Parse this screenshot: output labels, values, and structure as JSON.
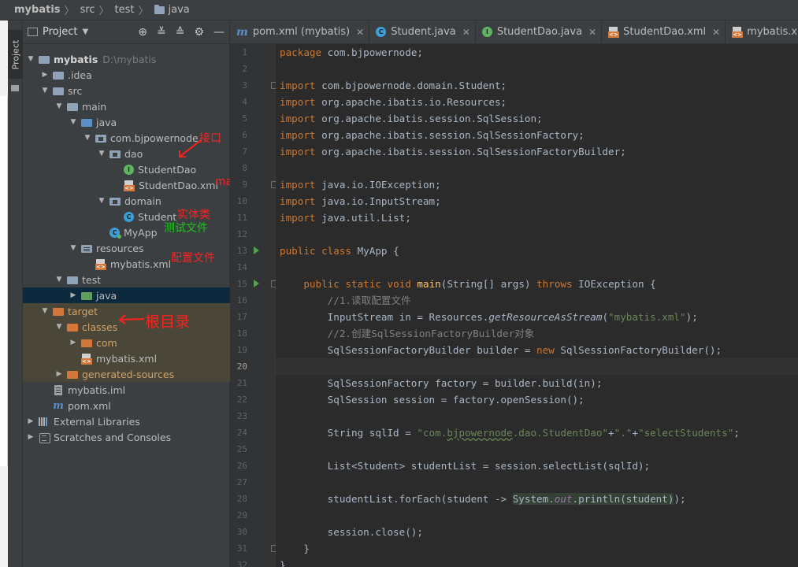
{
  "breadcrumb": [
    {
      "label": "mybatis",
      "bold": true
    },
    {
      "label": "src"
    },
    {
      "label": "test"
    },
    {
      "label": "java",
      "folder": true
    }
  ],
  "tool_window_stripe": {
    "label": "Project"
  },
  "project_panel": {
    "title": "Project",
    "tools": [
      "crosshair-icon",
      "expand-all-icon",
      "collapse-all-icon",
      "gear-icon",
      "minimize-icon"
    ]
  },
  "tree": [
    {
      "label": "mybatis",
      "hint": "D:\\mybatis",
      "depth": 0,
      "arrow": "down",
      "icon": "folder",
      "style": "root"
    },
    {
      "label": ".idea",
      "depth": 1,
      "arrow": "right",
      "icon": "folder"
    },
    {
      "label": "src",
      "depth": 1,
      "arrow": "down",
      "icon": "folder"
    },
    {
      "label": "main",
      "depth": 2,
      "arrow": "down",
      "icon": "folder"
    },
    {
      "label": "java",
      "depth": 3,
      "arrow": "down",
      "icon": "folder-blue"
    },
    {
      "label": "com.bjpowernode",
      "depth": 4,
      "arrow": "down",
      "icon": "package"
    },
    {
      "label": "dao",
      "depth": 5,
      "arrow": "down",
      "icon": "package"
    },
    {
      "label": "StudentDao",
      "depth": 6,
      "arrow": "none",
      "icon": "interface"
    },
    {
      "label": "StudentDao.xml",
      "depth": 6,
      "arrow": "none",
      "icon": "xml"
    },
    {
      "label": "domain",
      "depth": 5,
      "arrow": "down",
      "icon": "package"
    },
    {
      "label": "Student",
      "depth": 6,
      "arrow": "none",
      "icon": "class"
    },
    {
      "label": "MyApp",
      "depth": 5,
      "arrow": "none",
      "icon": "class-run"
    },
    {
      "label": "resources",
      "depth": 3,
      "arrow": "down",
      "icon": "folder-res"
    },
    {
      "label": "mybatis.xml",
      "depth": 4,
      "arrow": "none",
      "icon": "xml"
    },
    {
      "label": "test",
      "depth": 2,
      "arrow": "down",
      "icon": "folder"
    },
    {
      "label": "java",
      "depth": 3,
      "arrow": "right",
      "icon": "folder-green",
      "selected": true
    },
    {
      "label": "target",
      "depth": 1,
      "arrow": "down",
      "icon": "folder-orange",
      "excluded": true
    },
    {
      "label": "classes",
      "depth": 2,
      "arrow": "down",
      "icon": "folder-orange",
      "excluded": true
    },
    {
      "label": "com",
      "depth": 3,
      "arrow": "right",
      "icon": "folder-orange",
      "excluded": true
    },
    {
      "label": "mybatis.xml",
      "depth": 3,
      "arrow": "none",
      "icon": "xml",
      "excluded": true
    },
    {
      "label": "generated-sources",
      "depth": 2,
      "arrow": "right",
      "icon": "folder-orange",
      "excluded": true
    },
    {
      "label": "mybatis.iml",
      "depth": 1,
      "arrow": "none",
      "icon": "iml"
    },
    {
      "label": "pom.xml",
      "depth": 1,
      "arrow": "none",
      "icon": "maven"
    },
    {
      "label": "External Libraries",
      "depth": 0,
      "arrow": "right",
      "icon": "libraries"
    },
    {
      "label": "Scratches and Consoles",
      "depth": 0,
      "arrow": "right",
      "icon": "scratches"
    }
  ],
  "annotations": [
    {
      "text": "接口",
      "color": "red",
      "size": "normal"
    },
    {
      "text": "mapper文件",
      "color": "red",
      "size": "normal"
    },
    {
      "text": "实体类",
      "color": "red",
      "size": "normal"
    },
    {
      "text": "测试文件",
      "color": "green",
      "size": "normal"
    },
    {
      "text": "配置文件",
      "color": "red",
      "size": "normal"
    },
    {
      "text": "根目录",
      "color": "red",
      "size": "big"
    }
  ],
  "tabs": [
    {
      "label": "pom.xml (mybatis)",
      "icon": "maven"
    },
    {
      "label": "Student.java",
      "icon": "class"
    },
    {
      "label": "StudentDao.java",
      "icon": "interface"
    },
    {
      "label": "StudentDao.xml",
      "icon": "xml"
    },
    {
      "label": "mybatis.xml",
      "icon": "xml"
    },
    {
      "label": "M",
      "icon": "class",
      "active": true
    }
  ],
  "editor": {
    "current_line": 20,
    "run_markers": [
      13,
      15
    ],
    "fold_markers": [
      3,
      9,
      15,
      31
    ],
    "lines": [
      {
        "n": 1,
        "t": [
          [
            "kw",
            "package "
          ],
          [
            "",
            "com.bjpowernode;"
          ]
        ]
      },
      {
        "n": 2,
        "t": []
      },
      {
        "n": 3,
        "t": [
          [
            "kw",
            "import "
          ],
          [
            "",
            "com.bjpowernode.domain.Student;"
          ]
        ]
      },
      {
        "n": 4,
        "t": [
          [
            "kw",
            "import "
          ],
          [
            "",
            "org.apache.ibatis.io.Resources;"
          ]
        ]
      },
      {
        "n": 5,
        "t": [
          [
            "kw",
            "import "
          ],
          [
            "",
            "org.apache.ibatis.session.SqlSession;"
          ]
        ]
      },
      {
        "n": 6,
        "t": [
          [
            "kw",
            "import "
          ],
          [
            "",
            "org.apache.ibatis.session.SqlSessionFactory;"
          ]
        ]
      },
      {
        "n": 7,
        "t": [
          [
            "kw",
            "import "
          ],
          [
            "",
            "org.apache.ibatis.session.SqlSessionFactoryBuilder;"
          ]
        ]
      },
      {
        "n": 8,
        "t": []
      },
      {
        "n": 9,
        "t": [
          [
            "kw",
            "import "
          ],
          [
            "",
            "java.io.IOException;"
          ]
        ]
      },
      {
        "n": 10,
        "t": [
          [
            "kw",
            "import "
          ],
          [
            "",
            "java.io.InputStream;"
          ]
        ]
      },
      {
        "n": 11,
        "t": [
          [
            "kw",
            "import "
          ],
          [
            "",
            "java.util.List;"
          ]
        ]
      },
      {
        "n": 12,
        "t": []
      },
      {
        "n": 13,
        "t": [
          [
            "kw",
            "public class "
          ],
          [
            "",
            "MyApp {"
          ]
        ]
      },
      {
        "n": 14,
        "t": []
      },
      {
        "n": 15,
        "t": [
          [
            "",
            "    "
          ],
          [
            "kw",
            "public static void "
          ],
          [
            "fn",
            "main"
          ],
          [
            "",
            "(String[] args) "
          ],
          [
            "kw",
            "throws "
          ],
          [
            "",
            "IOException {"
          ]
        ]
      },
      {
        "n": 16,
        "t": [
          [
            "",
            "        "
          ],
          [
            "cmt",
            "//1.读取配置文件"
          ]
        ]
      },
      {
        "n": 17,
        "t": [
          [
            "",
            "        InputStream in = Resources."
          ],
          [
            "it",
            "getResourceAsStream"
          ],
          [
            "",
            "("
          ],
          [
            "str",
            "\"mybatis.xml\""
          ],
          [
            "",
            "); "
          ]
        ]
      },
      {
        "n": 18,
        "t": [
          [
            "",
            "        "
          ],
          [
            "cmt",
            "//2.创建SqlSessionFactoryBuilder对象"
          ]
        ]
      },
      {
        "n": 19,
        "t": [
          [
            "",
            "        SqlSessionFactoryBuilder builder = "
          ],
          [
            "kw",
            "new "
          ],
          [
            "",
            "SqlSessionFactoryBuilder();"
          ]
        ]
      },
      {
        "n": 20,
        "t": []
      },
      {
        "n": 21,
        "t": [
          [
            "",
            "        SqlSessionFactory factory = builder.build(in);"
          ]
        ]
      },
      {
        "n": 22,
        "t": [
          [
            "",
            "        SqlSession session = factory.openSession();"
          ]
        ]
      },
      {
        "n": 23,
        "t": []
      },
      {
        "n": 24,
        "t": [
          [
            "",
            "        String sqlId = "
          ],
          [
            "str",
            "\"com."
          ],
          [
            "str squig",
            "bjpowernode"
          ],
          [
            "str",
            ".dao.StudentDao\""
          ],
          [
            "",
            "+"
          ],
          [
            "str",
            "\".\""
          ],
          [
            "",
            "+"
          ],
          [
            "str",
            "\"selectStudents\""
          ],
          [
            "",
            ";"
          ]
        ]
      },
      {
        "n": 25,
        "t": []
      },
      {
        "n": 26,
        "t": [
          [
            "",
            "        List<Student> studentList = session.selectList(sqlId);"
          ]
        ]
      },
      {
        "n": 27,
        "t": []
      },
      {
        "n": 28,
        "t": [
          [
            "",
            "        studentList.forEach(student -> "
          ],
          [
            "hl",
            "System."
          ],
          [
            "hl st",
            "out"
          ],
          [
            "hl",
            ".println(student)"
          ],
          [
            "",
            ");"
          ]
        ]
      },
      {
        "n": 29,
        "t": []
      },
      {
        "n": 30,
        "t": [
          [
            "",
            "        session.close();"
          ]
        ]
      },
      {
        "n": 31,
        "t": [
          [
            "",
            "    }"
          ]
        ]
      },
      {
        "n": 32,
        "t": [
          [
            "",
            "}"
          ]
        ]
      }
    ]
  }
}
